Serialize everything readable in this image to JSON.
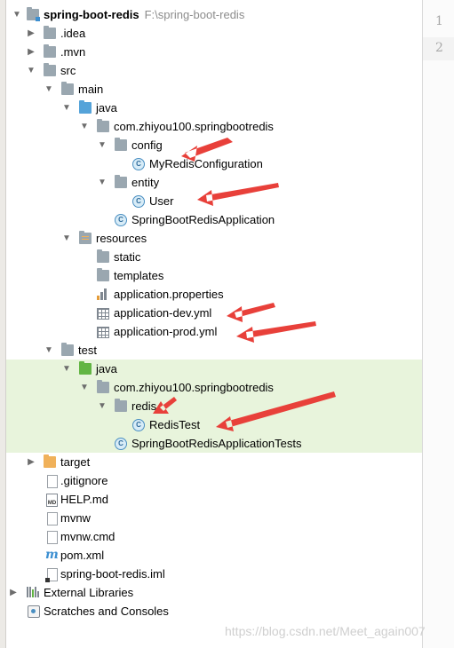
{
  "project_tree": {
    "rows": [
      {
        "name": "spring-boot-redis",
        "path": "F:\\spring-boot-redis",
        "bold": true,
        "expanded": true,
        "icon": "module-folder-icon",
        "depth": 0
      },
      {
        "name": ".idea",
        "expanded": false,
        "icon": "folder-icon",
        "depth": 1
      },
      {
        "name": ".mvn",
        "expanded": false,
        "icon": "folder-icon",
        "depth": 1
      },
      {
        "name": "src",
        "expanded": true,
        "icon": "folder-icon",
        "depth": 1
      },
      {
        "name": "main",
        "expanded": true,
        "icon": "folder-icon",
        "depth": 2
      },
      {
        "name": "java",
        "expanded": true,
        "icon": "source-folder-icon",
        "depth": 3
      },
      {
        "name": "com.zhiyou100.springbootredis",
        "expanded": true,
        "icon": "package-icon",
        "depth": 4
      },
      {
        "name": "config",
        "expanded": true,
        "icon": "package-icon",
        "depth": 5
      },
      {
        "name": "MyRedisConfiguration",
        "icon": "class-icon",
        "depth": 6
      },
      {
        "name": "entity",
        "expanded": true,
        "icon": "package-icon",
        "depth": 5
      },
      {
        "name": "User",
        "icon": "class-icon",
        "depth": 6
      },
      {
        "name": "SpringBootRedisApplication",
        "icon": "class-icon",
        "depth": 5
      },
      {
        "name": "resources",
        "expanded": true,
        "icon": "resources-folder-icon",
        "depth": 3
      },
      {
        "name": "static",
        "icon": "folder-icon",
        "depth": 4
      },
      {
        "name": "templates",
        "icon": "folder-icon",
        "depth": 4
      },
      {
        "name": "application.properties",
        "icon": "properties-file-icon",
        "depth": 4
      },
      {
        "name": "application-dev.yml",
        "icon": "yml-file-icon",
        "depth": 4
      },
      {
        "name": "application-prod.yml",
        "icon": "yml-file-icon",
        "depth": 4
      },
      {
        "name": "test",
        "expanded": true,
        "icon": "folder-icon",
        "depth": 2
      },
      {
        "name": "java",
        "expanded": true,
        "icon": "test-source-folder-icon",
        "depth": 3,
        "highlight": true
      },
      {
        "name": "com.zhiyou100.springbootredis",
        "expanded": true,
        "icon": "package-icon",
        "depth": 4,
        "highlight": true
      },
      {
        "name": "redis",
        "expanded": true,
        "icon": "package-icon",
        "depth": 5,
        "highlight": true
      },
      {
        "name": "RedisTest",
        "icon": "class-icon",
        "depth": 6,
        "highlight": true
      },
      {
        "name": "SpringBootRedisApplicationTests",
        "icon": "class-icon",
        "depth": 5,
        "highlight": true
      },
      {
        "name": "target",
        "expanded": false,
        "icon": "excluded-folder-icon",
        "depth": 1,
        "target": true
      },
      {
        "name": ".gitignore",
        "icon": "file-icon",
        "depth": 2
      },
      {
        "name": "HELP.md",
        "icon": "markdown-file-icon",
        "depth": 2
      },
      {
        "name": "mvnw",
        "icon": "file-icon",
        "depth": 2
      },
      {
        "name": "mvnw.cmd",
        "icon": "file-icon",
        "depth": 2
      },
      {
        "name": "pom.xml",
        "icon": "maven-icon",
        "depth": 2
      },
      {
        "name": "spring-boot-redis.iml",
        "icon": "iml-file-icon",
        "depth": 2
      },
      {
        "name": "External Libraries",
        "expanded": false,
        "icon": "library-icon",
        "depth": 0
      },
      {
        "name": "Scratches and Consoles",
        "icon": "scratches-icon",
        "depth": 0
      }
    ]
  },
  "editor_gutter": {
    "line_numbers": [
      "1",
      "2"
    ]
  },
  "watermark": "https://blog.csdn.net/Meet_again007",
  "colors": {
    "highlight": "#e8f4dc",
    "annotation_arrow": "#e8403a",
    "class_icon_blue": "#4a8fc2"
  }
}
